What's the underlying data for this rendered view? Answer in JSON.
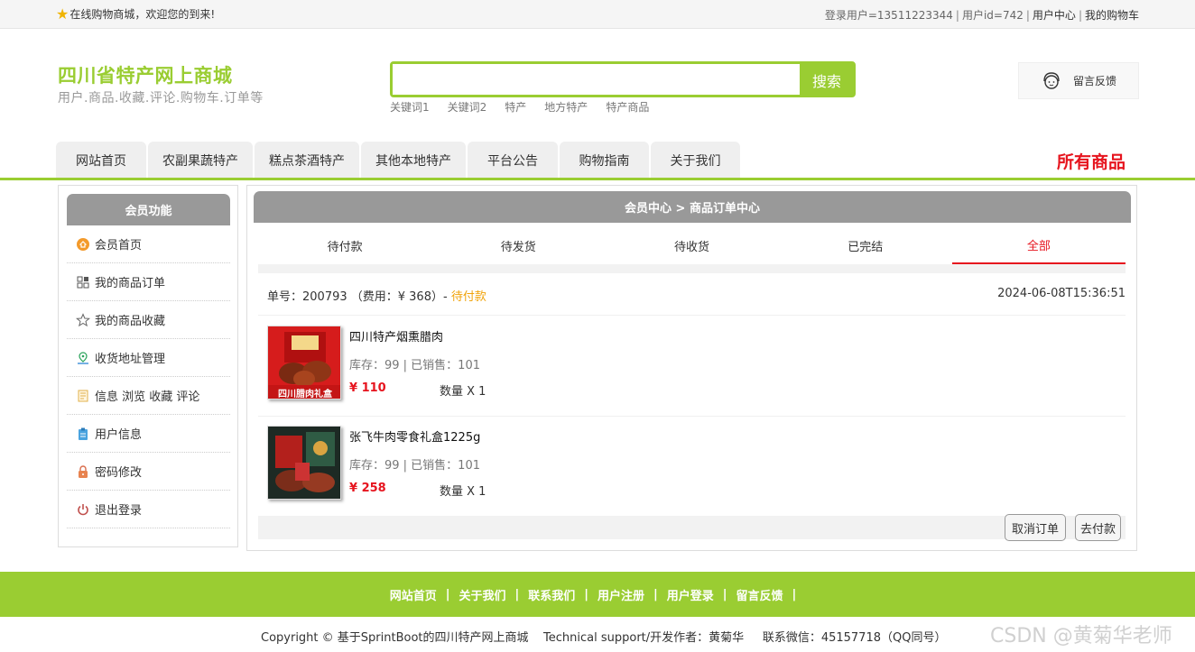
{
  "topbar": {
    "welcome": "在线购物商城，欢迎您的到来!",
    "user_label": "登录用户=13511223344",
    "user_id": "用户id=742",
    "user_center": "用户中心",
    "my_cart": "我的购物车"
  },
  "brand": {
    "title": "四川省特产网上商城",
    "subtitle": "用户.商品.收藏.评论.购物车.订单等"
  },
  "search": {
    "placeholder": "",
    "button": "搜索",
    "keywords": [
      "关键词1",
      "关键词2",
      "特产",
      "地方特产",
      "特产商品"
    ]
  },
  "feedback": "留言反馈",
  "nav": {
    "tabs": [
      "网站首页",
      "农副果蔬特产",
      "糕点茶酒特产",
      "其他本地特产",
      "平台公告",
      "购物指南",
      "关于我们"
    ],
    "all_goods": "所有商品"
  },
  "sidebar": {
    "title": "会员功能",
    "items": [
      "会员首页",
      "我的商品订单",
      "我的商品收藏",
      "收货地址管理",
      "信息 浏览 收藏 评论",
      "用户信息",
      "密码修改",
      "退出登录"
    ]
  },
  "main": {
    "breadcrumb": "会员中心 > 商品订单中心",
    "status_tabs": [
      "待付款",
      "待发货",
      "待收货",
      "已完结",
      "全部"
    ],
    "active_tab": "全部"
  },
  "order": {
    "number_text": "单号：200793 （费用：¥ 368）-",
    "status": "待付款",
    "time": "2024-06-08T15:36:51",
    "goods": [
      {
        "name": "四川特产烟熏腊肉",
        "stock": "库存：99 | 已销售：101",
        "price": "¥ 110",
        "qty": "数量 X 1",
        "thumb_label": "四川腊肉礼盒"
      },
      {
        "name": "张飞牛肉零食礼盒1225g",
        "stock": "库存：99 | 已销售：101",
        "price": "¥ 258",
        "qty": "数量 X 1",
        "thumb_label": ""
      }
    ],
    "cancel_button": "取消订单",
    "pay_button": "去付款"
  },
  "footer": {
    "links": [
      "网站首页",
      "关于我们",
      "联系我们",
      "用户注册",
      "用户登录",
      "留言反馈"
    ],
    "copyright": "Copyright © 基于SprintBoot的四川特产网上商城    Technical support/开发作者：黄菊华     联系微信：45157718（QQ同号）"
  },
  "watermark": "CSDN @黄菊华老师",
  "colors": {
    "brand_green": "#9acd32",
    "accent_red": "#e6141e",
    "pending_orange": "#f0a30a",
    "header_gray": "#999999"
  }
}
